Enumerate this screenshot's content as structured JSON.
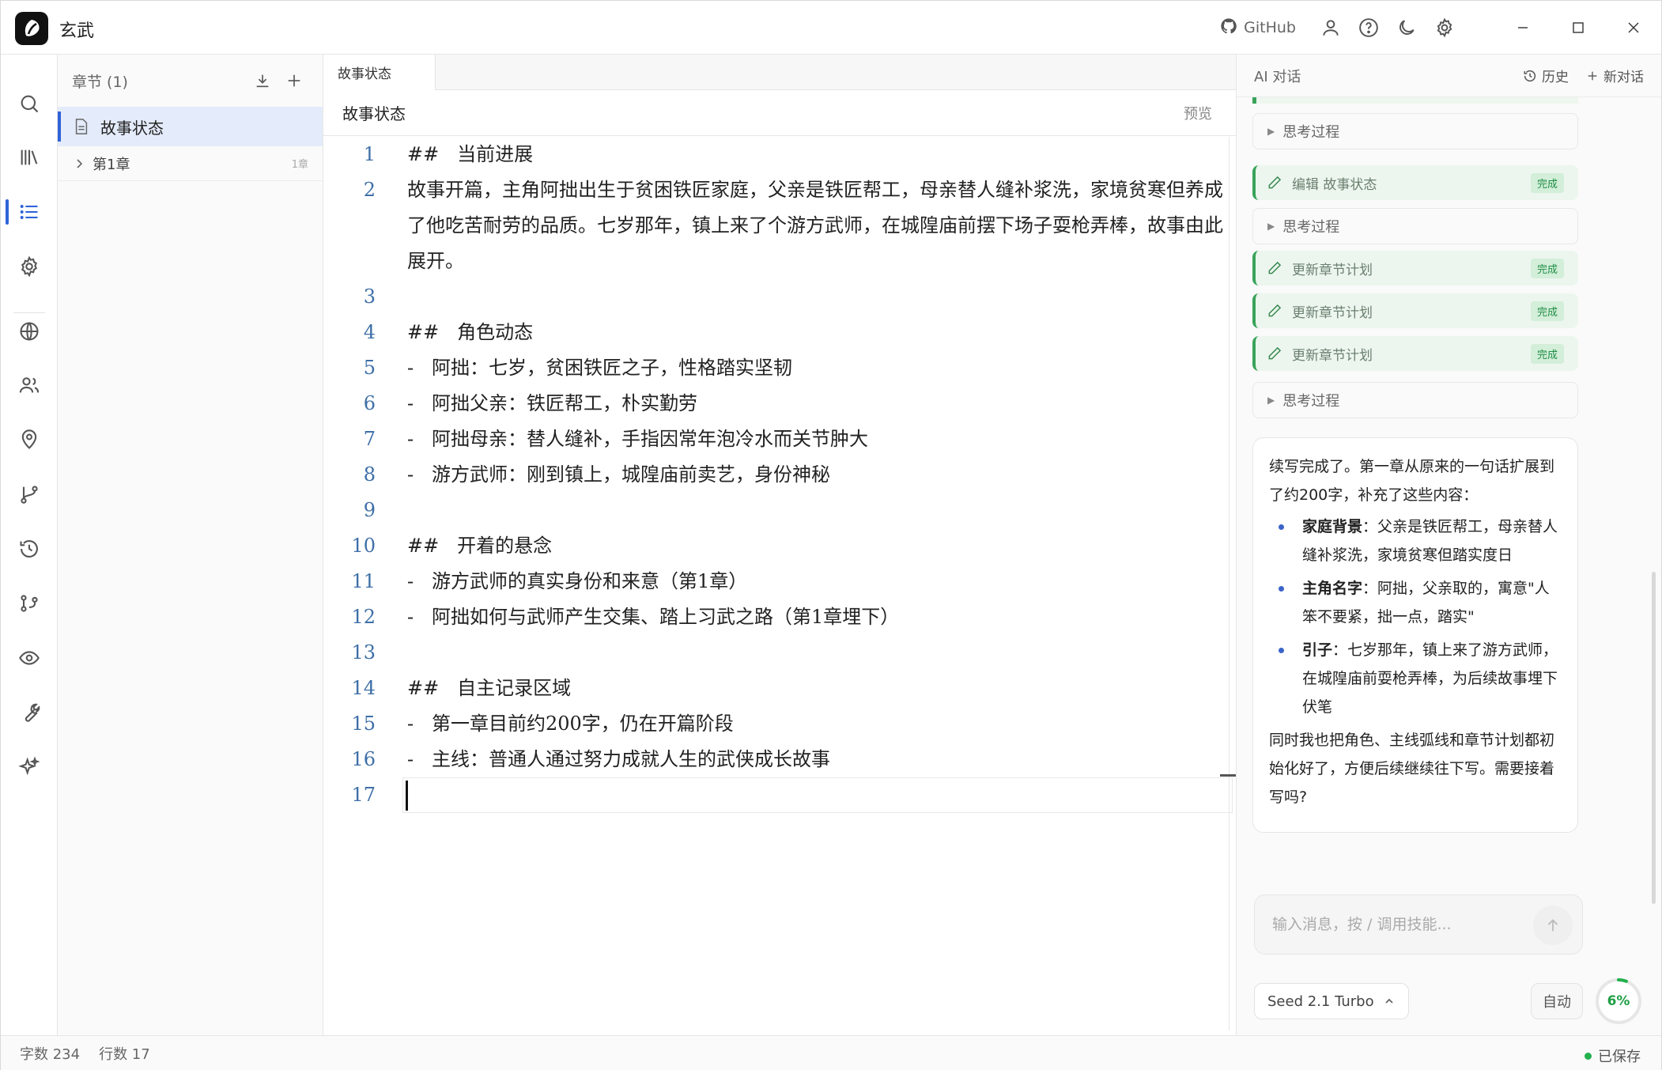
{
  "app": {
    "title": "玄武",
    "github_label": "GitHub"
  },
  "chapters": {
    "header": "章节 (1)",
    "active_item": "故事状态",
    "items": [
      {
        "label": "第1章",
        "count": "1章"
      }
    ]
  },
  "editor": {
    "tab_label": "故事状态",
    "doc_title": "故事状态",
    "preview_label": "预览",
    "lines": [
      {
        "n": "1",
        "text": "##   当前进展"
      },
      {
        "n": "2",
        "text": "故事开篇，主角阿拙出生于贫困铁匠家庭，父亲是铁匠帮工，母亲替人缝补浆洗，家境贫寒但养成了他吃苦耐劳的品质。七岁那年，镇上来了个游方武师，在城隍庙前摆下场子耍枪弄棒，故事由此展开。"
      },
      {
        "n": "3",
        "text": ""
      },
      {
        "n": "4",
        "text": "##   角色动态"
      },
      {
        "n": "5",
        "text": "-   阿拙：七岁，贫困铁匠之子，性格踏实坚韧"
      },
      {
        "n": "6",
        "text": "-   阿拙父亲：铁匠帮工，朴实勤劳"
      },
      {
        "n": "7",
        "text": "-   阿拙母亲：替人缝补，手指因常年泡冷水而关节肿大"
      },
      {
        "n": "8",
        "text": "-   游方武师：刚到镇上，城隍庙前卖艺，身份神秘"
      },
      {
        "n": "9",
        "text": ""
      },
      {
        "n": "10",
        "text": "##   开着的悬念"
      },
      {
        "n": "11",
        "text": "-   游方武师的真实身份和来意（第1章）"
      },
      {
        "n": "12",
        "text": "-   阿拙如何与武师产生交集、踏上习武之路（第1章埋下）"
      },
      {
        "n": "13",
        "text": ""
      },
      {
        "n": "14",
        "text": "##   自主记录区域"
      },
      {
        "n": "15",
        "text": "-   第一章目前约200字，仍在开篇阶段"
      },
      {
        "n": "16",
        "text": "-   主线：普通人通过努力成就人生的武侠成长故事"
      },
      {
        "n": "17",
        "text": ""
      }
    ]
  },
  "status": {
    "word_count": "字数 234",
    "line_count": "行数 17",
    "saved": "已保存"
  },
  "ai": {
    "title": "AI 对话",
    "history_label": "历史",
    "new_chat_label": "新对话",
    "think_label": "思考过程",
    "done_label": "完成",
    "tool_edit": "编辑 故事状态",
    "tool_update": "更新章节计划",
    "message": {
      "intro": "续写完成了。第一章从原来的一句话扩展到了约200字，补充了这些内容：",
      "bullets": [
        {
          "key": "家庭背景",
          "text": "：父亲是铁匠帮工，母亲替人缝补浆洗，家境贫寒但踏实度日"
        },
        {
          "key": "主角名字",
          "text": "：阿拙，父亲取的，寓意\"人笨不要紧，拙一点，踏实\""
        },
        {
          "key": "引子",
          "text": "：七岁那年，镇上来了游方武师，在城隍庙前耍枪弄棒，为后续故事埋下伏笔"
        }
      ],
      "outro": "同时我也把角色、主线弧线和章节计划都初始化好了，方便后续继续往下写。需要接着写吗?"
    },
    "input_placeholder": "输入消息，按 / 调用技能...",
    "model_label": "Seed 2.1 Turbo",
    "auto_label": "自动",
    "usage_percent": 6,
    "usage_label": "6%"
  },
  "colors": {
    "accent": "#2f63d8",
    "success": "#22b14c",
    "line_number": "#3e6fa8"
  }
}
